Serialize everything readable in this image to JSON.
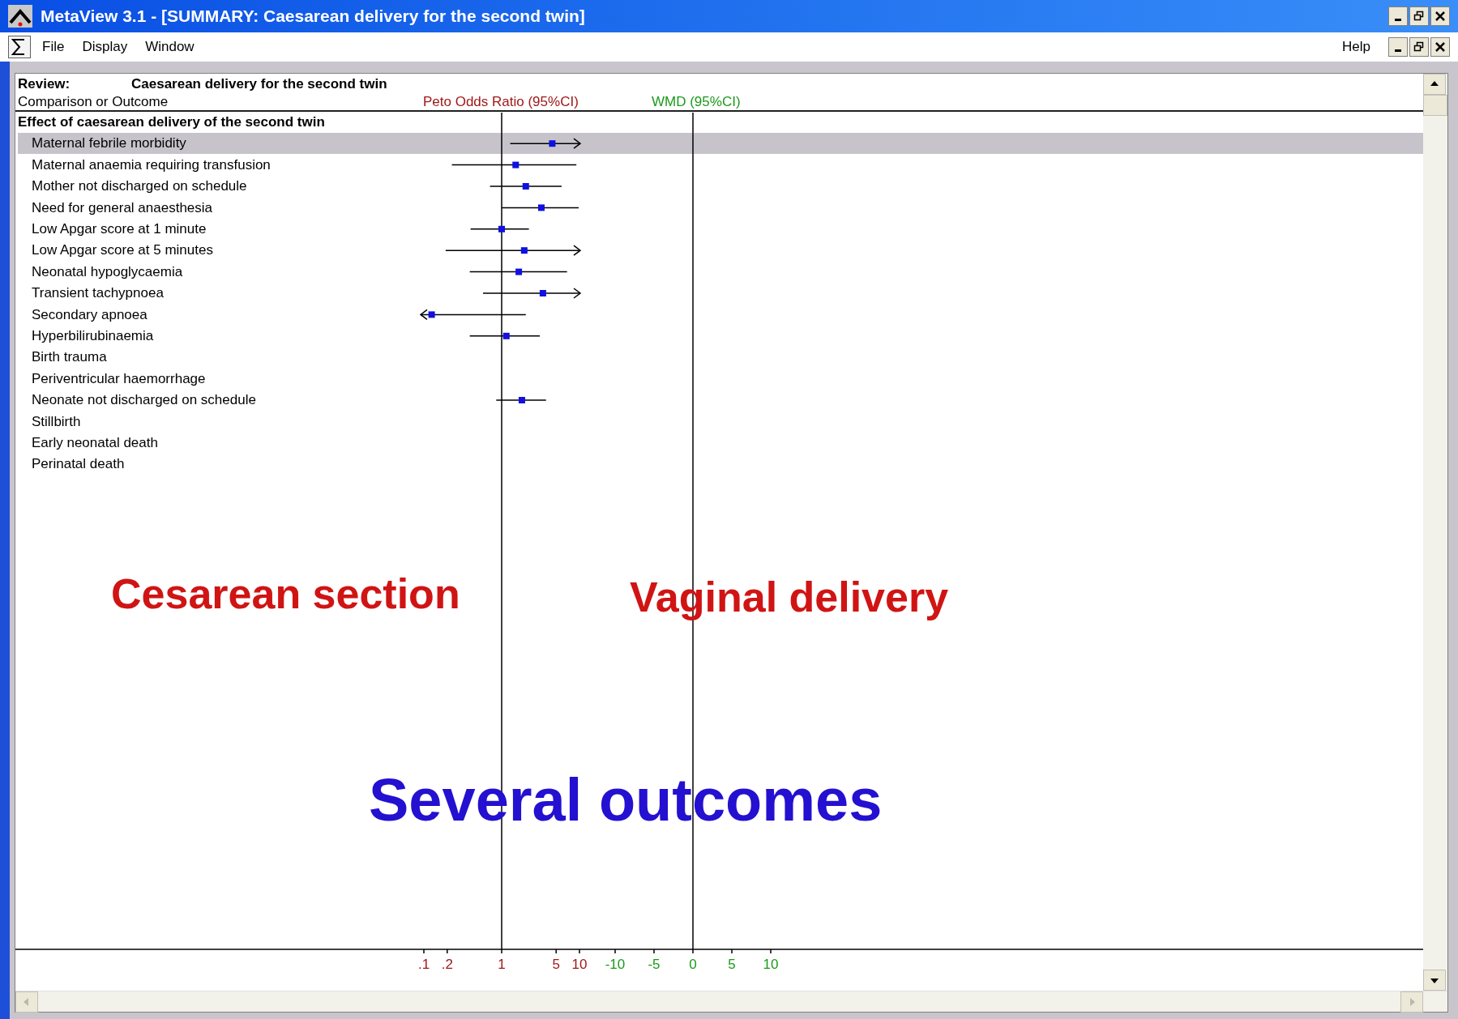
{
  "window": {
    "title": "MetaView 3.1 - [SUMMARY: Caesarean delivery for the second twin]"
  },
  "menu": [
    {
      "label": "File"
    },
    {
      "label": "Display"
    },
    {
      "label": "Window"
    }
  ],
  "help_menu": {
    "label": "Help"
  },
  "review": {
    "label": "Review:",
    "title": "Caesarean delivery for the second twin"
  },
  "columns": {
    "outcome": "Comparison or Outcome",
    "or_header": "Peto Odds Ratio (95%CI)",
    "wmd_header": "WMD (95%CI)"
  },
  "group": "Effect of caesarean delivery of the second twin",
  "rows": [
    {
      "label": "Maternal febrile morbidity",
      "selected": true
    },
    {
      "label": "Maternal anaemia requiring transfusion",
      "selected": false
    },
    {
      "label": "Mother not discharged on schedule",
      "selected": false
    },
    {
      "label": "Need for general anaesthesia",
      "selected": false
    },
    {
      "label": "Low Apgar score at 1 minute",
      "selected": false
    },
    {
      "label": "Low Apgar score at 5 minutes",
      "selected": false
    },
    {
      "label": "Neonatal hypoglycaemia",
      "selected": false
    },
    {
      "label": "Transient tachypnoea",
      "selected": false
    },
    {
      "label": "Secondary apnoea",
      "selected": false
    },
    {
      "label": "Hyperbilirubinaemia",
      "selected": false
    },
    {
      "label": "Birth trauma",
      "selected": false
    },
    {
      "label": "Periventricular haemorrhage",
      "selected": false
    },
    {
      "label": "Neonate not discharged on schedule",
      "selected": false
    },
    {
      "label": "Stillbirth",
      "selected": false
    },
    {
      "label": "Early neonatal death",
      "selected": false
    },
    {
      "label": "Perinatal death",
      "selected": false
    }
  ],
  "or_axis": {
    "ticks": [
      ".1",
      ".2",
      "1",
      "5",
      "10"
    ]
  },
  "wmd_axis": {
    "ticks": [
      "-10",
      "-5",
      "0",
      "5",
      "10"
    ]
  },
  "annotations": [
    {
      "text": "Cesarean section",
      "color": "#d01414"
    },
    {
      "text": "Vaginal delivery",
      "color": "#d01414"
    },
    {
      "text": "Several outcomes",
      "color": "#2410d0"
    }
  ]
}
